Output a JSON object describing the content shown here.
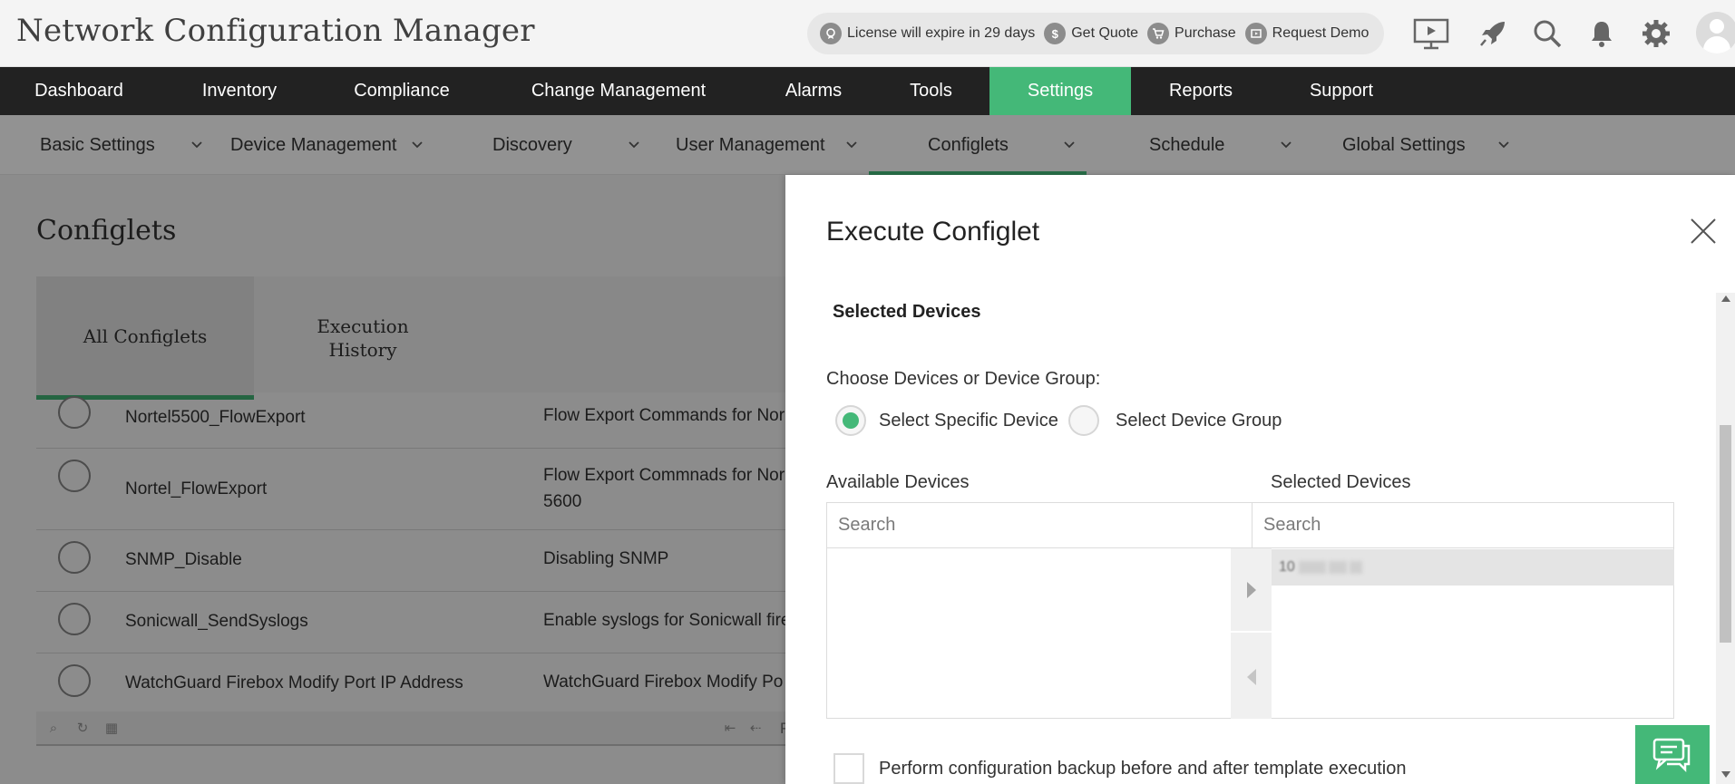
{
  "header": {
    "app_title": "Network Configuration Manager",
    "license_text": "License will expire in 29 days",
    "get_quote": "Get Quote",
    "purchase": "Purchase",
    "request_demo": "Request Demo",
    "icons": [
      "presentation-icon",
      "rocket-icon",
      "search-icon",
      "bell-icon",
      "gear-icon",
      "user-avatar-icon"
    ]
  },
  "main_nav": {
    "items": [
      {
        "label": "Dashboard"
      },
      {
        "label": "Inventory"
      },
      {
        "label": "Compliance"
      },
      {
        "label": "Change Management"
      },
      {
        "label": "Alarms"
      },
      {
        "label": "Tools"
      },
      {
        "label": "Settings"
      },
      {
        "label": "Reports"
      },
      {
        "label": "Support"
      }
    ],
    "active": "Settings"
  },
  "sub_nav": {
    "items": [
      {
        "label": "Basic Settings"
      },
      {
        "label": "Device Management"
      },
      {
        "label": "Discovery"
      },
      {
        "label": "User Management"
      },
      {
        "label": "Configlets"
      },
      {
        "label": "Schedule"
      },
      {
        "label": "Global Settings"
      }
    ],
    "active": "Configlets"
  },
  "page": {
    "title": "Configlets",
    "tabs": [
      {
        "label": "All Configlets"
      },
      {
        "label": "Execution History"
      }
    ],
    "active_tab": "All Configlets",
    "rows": [
      {
        "name": "Nortel5500_FlowExport",
        "desc": [
          "Flow Export Commands for Nor"
        ]
      },
      {
        "name": "Nortel_FlowExport",
        "desc": [
          "Flow Export Commnads for Nor",
          "5600"
        ]
      },
      {
        "name": "SNMP_Disable",
        "desc": [
          "Disabling SNMP"
        ]
      },
      {
        "name": "Sonicwall_SendSyslogs",
        "desc": [
          "Enable syslogs for Sonicwall fire"
        ]
      },
      {
        "name": "WatchGuard Firebox Modify Port IP Address",
        "desc": [
          "WatchGuard Firebox Modify Po"
        ]
      }
    ],
    "pager_partial": "P"
  },
  "panel": {
    "title": "Execute Configlet",
    "section_heading": "Selected Devices",
    "choose_label": "Choose Devices or Device Group:",
    "options": [
      {
        "label": "Select Specific Device",
        "selected": true
      },
      {
        "label": "Select Device Group",
        "selected": false
      }
    ],
    "available_label": "Available Devices",
    "selected_label": "Selected Devices",
    "search_placeholder": "Search",
    "selected_item_prefix": "10",
    "backup_label": "Perform configuration backup before and after template execution",
    "backup_checked": false
  },
  "colors": {
    "accent": "#44b878",
    "nav_bg": "#222222",
    "overlay": "rgba(0,0,0,0.45)"
  }
}
